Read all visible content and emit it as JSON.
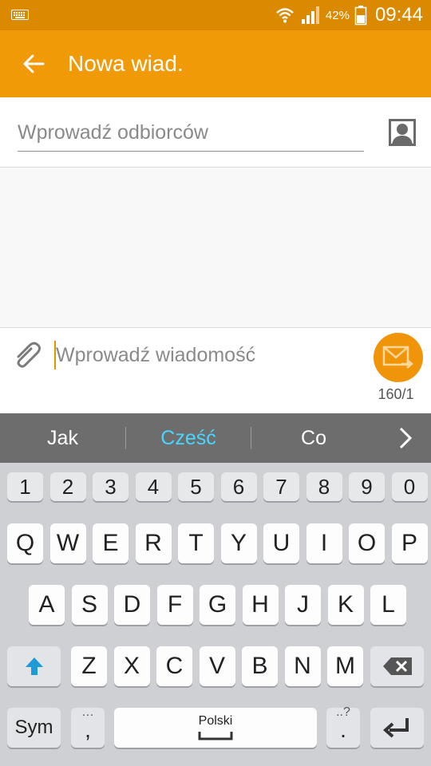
{
  "status_bar": {
    "battery": "42%",
    "time": "09:44",
    "icons": [
      "keyboard-icon",
      "wifi-icon",
      "signal-icon",
      "battery-icon"
    ]
  },
  "app_bar": {
    "title": "Nowa wiad.",
    "back_icon": "arrow-left-icon"
  },
  "recipient": {
    "placeholder": "Wprowadź odbiorców",
    "contact_icon": "contact-icon"
  },
  "composer": {
    "placeholder": "Wprowadź wiadomość",
    "attach_icon": "paperclip-icon",
    "send_icon": "envelope-send-icon",
    "counter": "160/1"
  },
  "suggestions": {
    "items": [
      "Jak",
      "Cześć",
      "Co"
    ],
    "active_index": 1,
    "active_color": "#46d6ff"
  },
  "keyboard": {
    "numbers": [
      "1",
      "2",
      "3",
      "4",
      "5",
      "6",
      "7",
      "8",
      "9",
      "0"
    ],
    "row1": [
      "Q",
      "W",
      "E",
      "R",
      "T",
      "Y",
      "U",
      "I",
      "O",
      "P"
    ],
    "row2": [
      "A",
      "S",
      "D",
      "F",
      "G",
      "H",
      "J",
      "K",
      "L"
    ],
    "row3": [
      "Z",
      "X",
      "C",
      "V",
      "B",
      "N",
      "M"
    ],
    "sym_label": "Sym",
    "comma_label": ",",
    "space_label": "Polski",
    "period_label": ".",
    "comma_hint": "…",
    "period_hint": "..?"
  },
  "colors": {
    "status_bar": "#db8a00",
    "app_bar": "#f19a08",
    "send_button": "#f0950a",
    "shift_arrow": "#1e9bd7"
  }
}
